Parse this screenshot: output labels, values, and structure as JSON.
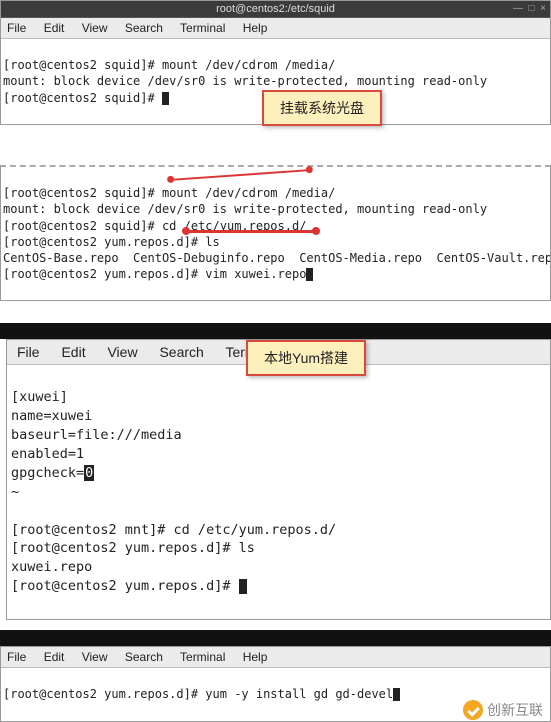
{
  "menubar": {
    "file": "File",
    "edit": "Edit",
    "view": "View",
    "search": "Search",
    "terminal": "Terminal",
    "help": "Help"
  },
  "win1": {
    "title": "root@centos2:/etc/squid",
    "lines": {
      "l1": "[root@centos2 squid]# mount /dev/cdrom /media/",
      "l2": "mount: block device /dev/sr0 is write-protected, mounting read-only",
      "l3": "[root@centos2 squid]# "
    }
  },
  "callout1": "挂载系统光盘",
  "win2": {
    "lines": {
      "l1": "[root@centos2 squid]# mount /dev/cdrom /media/",
      "l2": "mount: block device /dev/sr0 is write-protected, mounting read-only",
      "l3": "[root@centos2 squid]# cd /etc/yum.repos.d/",
      "l4": "[root@centos2 yum.repos.d]# ls",
      "l5": "CentOS-Base.repo  CentOS-Debuginfo.repo  CentOS-Media.repo  CentOS-Vault.repo",
      "l6": "[root@centos2 yum.repos.d]# vim xuwei.repo"
    }
  },
  "win3": {
    "config": {
      "l1": "[xuwei]",
      "l2": "name=xuwei",
      "l3": "baseurl=file:///media",
      "l4": "enabled=1",
      "l5a": "gpgcheck=",
      "l5b": "0"
    },
    "tilde": "~",
    "lines": {
      "l1": "[root@centos2 mnt]# cd /etc/yum.repos.d/",
      "l2": "[root@centos2 yum.repos.d]# ls",
      "l3": "xuwei.repo",
      "l4": "[root@centos2 yum.repos.d]# "
    }
  },
  "callout2": "本地Yum搭建",
  "win4": {
    "lines": {
      "l1": "[root@centos2 yum.repos.d]# yum -y install gd gd-devel"
    }
  },
  "watermark": "创新互联"
}
